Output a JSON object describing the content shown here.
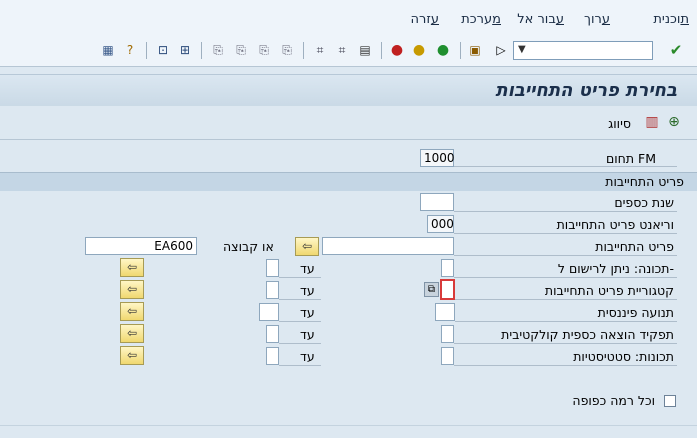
{
  "menu": {
    "items": [
      {
        "label": "תוכנית",
        "acc": "ת",
        "rest": "וכנית"
      },
      {
        "label": "ערוך",
        "acc": "ע",
        "rest": "רוך"
      },
      {
        "label": "עבור אל",
        "acc": "ע",
        "rest": "בור אל"
      },
      {
        "label": "מערכת",
        "acc": "מ",
        "rest": "ערכת"
      },
      {
        "label": "עזרה",
        "acc": "ע",
        "rest": "זרה"
      }
    ]
  },
  "toolbar": {
    "command_field_value": "",
    "icons": [
      "enter-icon",
      "dropdown-icon",
      "save-icon",
      "back-icon",
      "exit-icon",
      "cancel-icon",
      "print-icon",
      "find-icon",
      "find-next-icon",
      "first-page-icon",
      "previous-page-icon",
      "next-page-icon",
      "last-page-icon",
      "create-session-icon",
      "shortcut-icon",
      "help-icon",
      "customize-layout-icon"
    ]
  },
  "title": "בחירת פריט התחייבות",
  "app_toolbar": {
    "execute_icon": "execute-icon",
    "multi_select_icon": "multiple-selection-icon",
    "sort_label": "סיווג"
  },
  "fields": {
    "fm_area_label": "תחום FM",
    "fm_area_value": "1000",
    "group_title": "פריט התחייבות",
    "fiscal_year_label": "שנת כספים",
    "fiscal_year_value": "",
    "variant_label": "וריאנט פריט התחייבות",
    "variant_value": "000",
    "commitment_item_label": "פריט התחייבות",
    "commitment_item_value": "",
    "or_group_label": "או קבוצה",
    "group_value": "EA600",
    "posting_label": "תכונה: ניתן לרישום ל-",
    "category_label": "קטגוריית פריט התחייבות",
    "category_value": "",
    "financial_trans_label": "תנועה פיננסית",
    "collective_label": "תפקיד הוצאה כספית קולקטיבית",
    "statistical_label": "תכונות: סטטיסטיות",
    "to_label": "עד",
    "all_levels_label": "וכל רמה כפופה"
  }
}
